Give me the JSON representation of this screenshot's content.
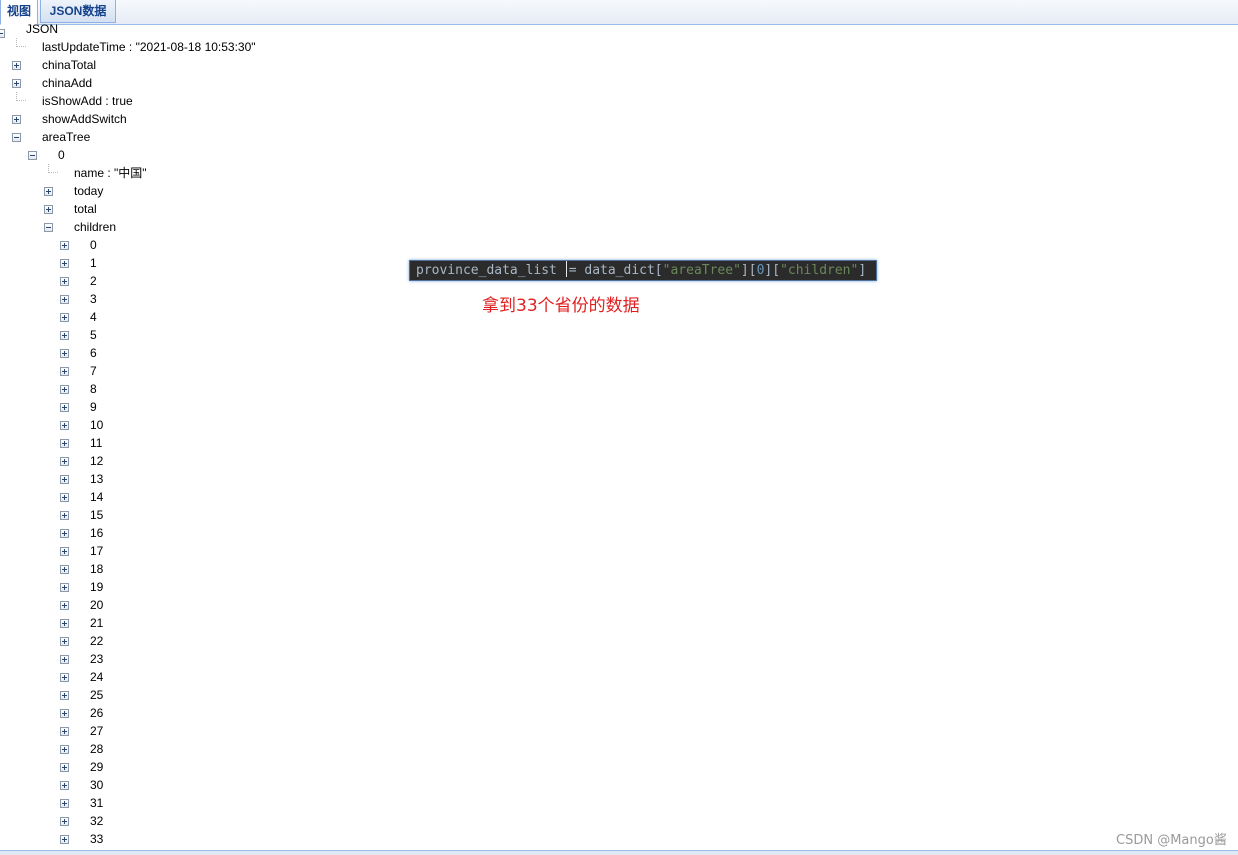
{
  "tabs": [
    {
      "label": "视图",
      "active": true
    },
    {
      "label": "JSON数据",
      "active": false
    }
  ],
  "tree": {
    "root": "JSON",
    "items": [
      {
        "label": "lastUpdateTime : \"2021-08-18 10:53:30\"",
        "state": "leaf"
      },
      {
        "label": "chinaTotal",
        "state": "collapsed"
      },
      {
        "label": "chinaAdd",
        "state": "collapsed"
      },
      {
        "label": "isShowAdd : true",
        "state": "leaf"
      },
      {
        "label": "showAddSwitch",
        "state": "collapsed"
      },
      {
        "label": "areaTree",
        "state": "expanded"
      }
    ],
    "area_index": "0",
    "area_items": [
      {
        "label": "name : \"中国\"",
        "state": "leaf"
      },
      {
        "label": "today",
        "state": "collapsed"
      },
      {
        "label": "total",
        "state": "collapsed"
      },
      {
        "label": "children",
        "state": "expanded"
      }
    ],
    "children": [
      "0",
      "1",
      "2",
      "3",
      "4",
      "5",
      "6",
      "7",
      "8",
      "9",
      "10",
      "11",
      "12",
      "13",
      "14",
      "15",
      "16",
      "17",
      "18",
      "19",
      "20",
      "21",
      "22",
      "23",
      "24",
      "25",
      "26",
      "27",
      "28",
      "29",
      "30",
      "31",
      "32",
      "33"
    ]
  },
  "code": {
    "var": "province_data_list",
    "op": "= data_dict[",
    "key1": "\"areaTree\"",
    "mid1": "][",
    "idx": "0",
    "mid2": "][",
    "key2": "\"children\"",
    "end": "]"
  },
  "annotation": "拿到33个省份的数据",
  "watermark": "CSDN @Mango酱"
}
